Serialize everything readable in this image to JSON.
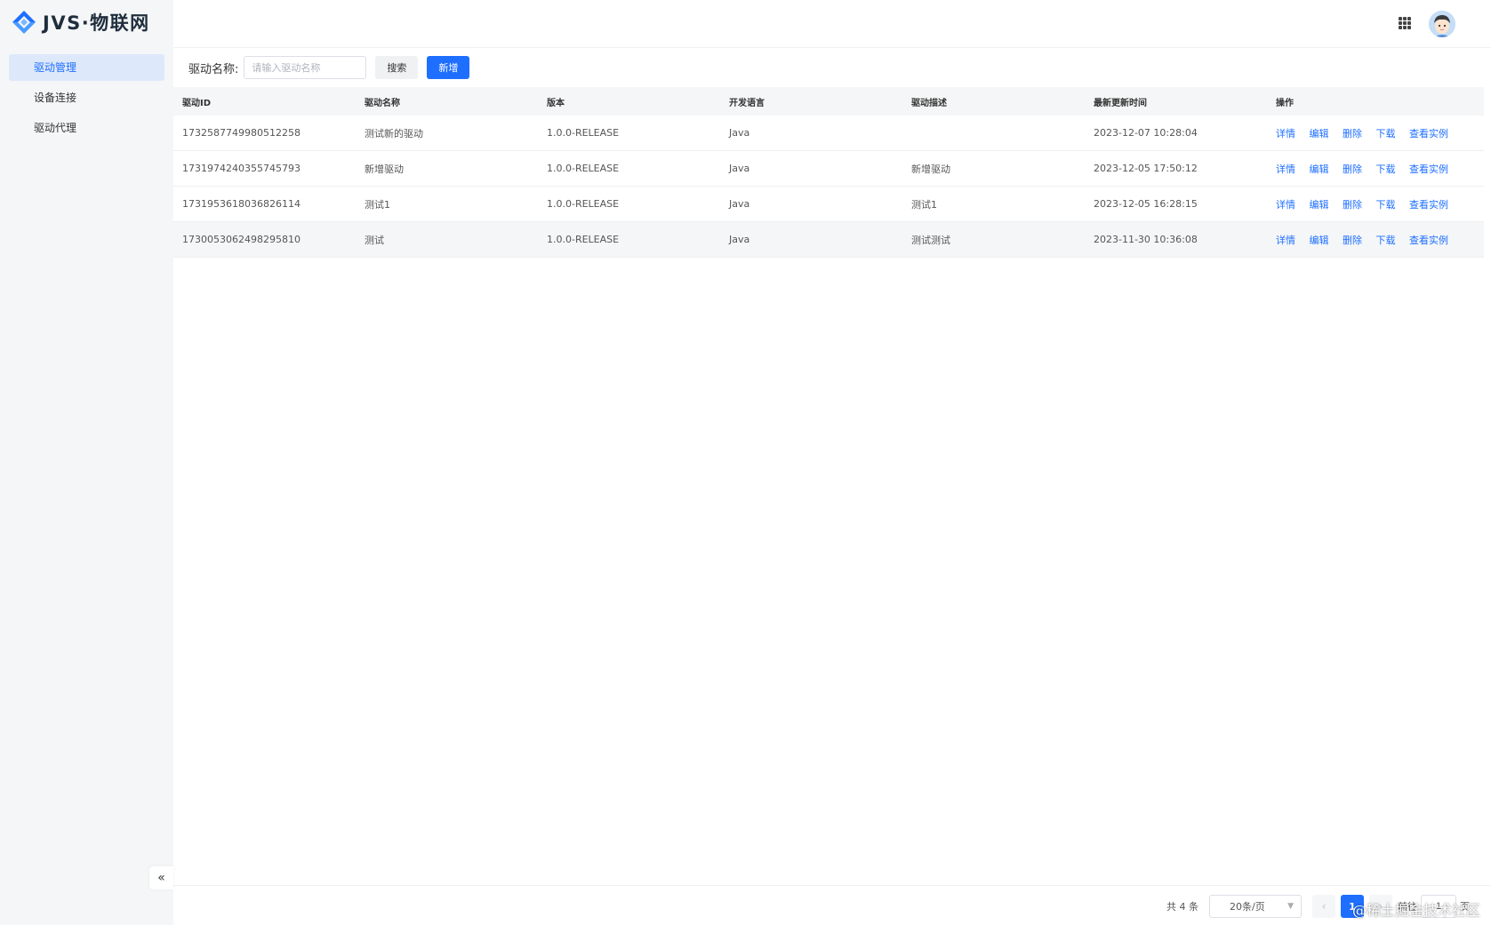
{
  "app": {
    "logo_text": "JVS·物联网"
  },
  "colors": {
    "primary": "#1e6fff",
    "sidebar_bg": "#f5f6f7",
    "active_menu_bg": "#dde8fb"
  },
  "sidebar": {
    "items": [
      {
        "label": "驱动管理",
        "active": true
      },
      {
        "label": "设备连接",
        "active": false
      },
      {
        "label": "驱动代理",
        "active": false
      }
    ],
    "collapse_icon": "«"
  },
  "header": {
    "apps_icon": "grid-icon",
    "avatar_icon": "user-avatar"
  },
  "toolbar": {
    "search_label": "驱动名称:",
    "search_placeholder": "请输入驱动名称",
    "search_button": "搜索",
    "add_button": "新增"
  },
  "table": {
    "columns": [
      "驱动ID",
      "驱动名称",
      "版本",
      "开发语言",
      "驱动描述",
      "最新更新时间",
      "操作"
    ],
    "actions": [
      "详情",
      "编辑",
      "删除",
      "下载",
      "查看实例"
    ],
    "rows": [
      {
        "id": "1732587749980512258",
        "name": "测试新的驱动",
        "version": "1.0.0-RELEASE",
        "language": "Java",
        "description": "",
        "updated": "2023-12-07 10:28:04"
      },
      {
        "id": "1731974240355745793",
        "name": "新增驱动",
        "version": "1.0.0-RELEASE",
        "language": "Java",
        "description": "新增驱动",
        "updated": "2023-12-05 17:50:12"
      },
      {
        "id": "1731953618036826114",
        "name": "测试1",
        "version": "1.0.0-RELEASE",
        "language": "Java",
        "description": "测试1",
        "updated": "2023-12-05 16:28:15"
      },
      {
        "id": "1730053062498295810",
        "name": "测试",
        "version": "1.0.0-RELEASE",
        "language": "Java",
        "description": "测试测试",
        "updated": "2023-11-30 10:36:08"
      }
    ]
  },
  "pagination": {
    "total": "共 4 条",
    "page_size": "20条/页",
    "prev": "‹",
    "current": "1",
    "next": "›",
    "goto_label": "前往",
    "goto_value": "1",
    "page_suffix": "页"
  },
  "watermark": "@稀土掘金技术社区"
}
